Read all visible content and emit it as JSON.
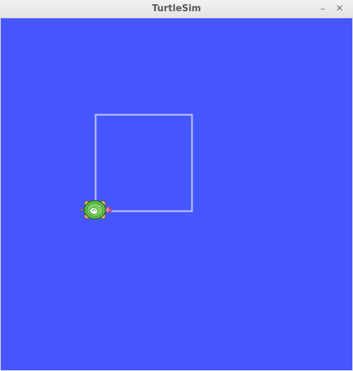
{
  "window": {
    "title": "TurtleSim",
    "minimize_glyph": "–",
    "close_glyph": "✕"
  },
  "canvas": {
    "background_color": "#4656ff",
    "pen_color": "#b3b8ff",
    "turtle": {
      "icon": "turtle-icon",
      "heading_deg": 0,
      "shell_color": "#5cc04a",
      "body_color": "#e8c27a"
    }
  }
}
